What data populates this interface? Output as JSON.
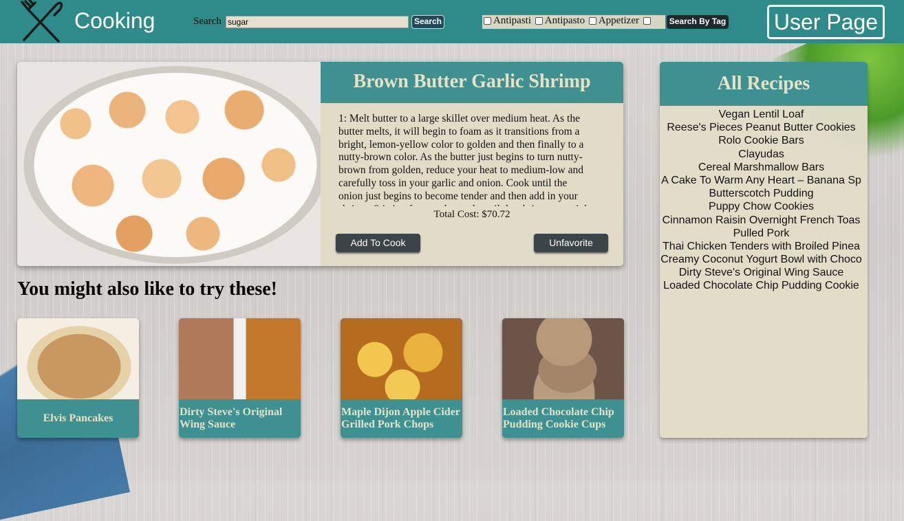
{
  "header": {
    "brand": "Cooking",
    "logo_icon": "fork-knife-icon",
    "search_label": "Search",
    "search_value": "sugar",
    "search_button": "Search",
    "tags": [
      "Antipasti",
      "Antipasto",
      "Appetizer"
    ],
    "tag_button": "Search By Tag",
    "user_button": "User Page"
  },
  "feature": {
    "title": "Brown Butter Garlic Shrimp",
    "instructions": "1: Melt butter to a large skillet over medium heat. As the butter melts, it will begin to foam as it transitions from a bright, lemon-yellow color to golden and then finally to a nutty-brown color. As the butter just begins to turn nutty-brown from golden, reduce your heat to medium-low and carefully toss in your garlic and onion. Cook until the onion just begins to become tender and then add in your shrimp. Stirring frequently, cook until the shrimp turn pink and lose",
    "total_cost": "Total Cost: $70.72",
    "add_button": "Add To Cook",
    "unfavorite_button": "Unfavorite"
  },
  "suggestions": {
    "heading": "You might also like to try these!",
    "items": [
      {
        "title": "Elvis Pancakes"
      },
      {
        "title": "Dirty Steve's Original Wing Sauce"
      },
      {
        "title": "Maple Dijon Apple Cider Grilled Pork Chops"
      },
      {
        "title": "Loaded Chocolate Chip Pudding Cookie Cups"
      }
    ]
  },
  "all_recipes": {
    "title": "All Recipes",
    "items": [
      "Vegan Lentil Loaf",
      "Reese's Pieces Peanut Butter Cookies",
      "Rolo Cookie Bars",
      "Clayudas",
      "Cereal Marshmallow Bars",
      "A Cake To Warm Any Heart – Banana Sp",
      "Butterscotch Pudding",
      "Puppy Chow Cookies",
      "Cinnamon Raisin Overnight French Toas",
      "Pulled Pork",
      "Thai Chicken Tenders with Broiled Pinea",
      "Creamy Coconut Yogurt Bowl with Choco",
      "Dirty Steve's Original Wing Sauce",
      "Loaded Chocolate Chip Pudding Cookie"
    ]
  },
  "colors": {
    "header": "#2f8a8a",
    "card_teal": "#3f9191",
    "cream_text": "#e7e1c7",
    "panel_bg": "#e1dcc8",
    "button_dark": "#3a4449"
  }
}
